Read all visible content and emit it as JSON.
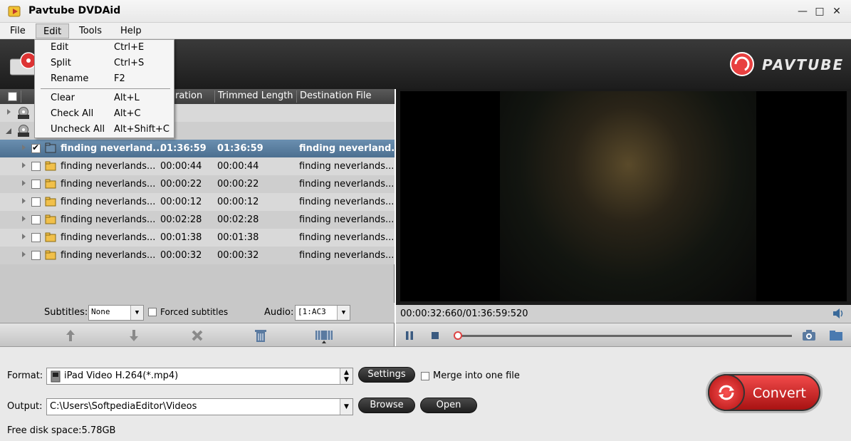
{
  "window": {
    "title": "Pavtube DVDAid",
    "controls": {
      "minimize": "—",
      "maximize": "□",
      "close": "✕"
    }
  },
  "menubar": [
    "File",
    "Edit",
    "Tools",
    "Help"
  ],
  "edit_menu": [
    {
      "label": "Edit",
      "shortcut": "Ctrl+E"
    },
    {
      "label": "Split",
      "shortcut": "Ctrl+S"
    },
    {
      "label": "Rename",
      "shortcut": "F2"
    },
    {
      "label": "Clear",
      "shortcut": "Alt+L"
    },
    {
      "label": "Check All",
      "shortcut": "Alt+C"
    },
    {
      "label": "Uncheck All",
      "shortcut": "Alt+Shift+C"
    }
  ],
  "brand": {
    "name": "PAVTUBE",
    "color": "#e84040"
  },
  "list": {
    "columns": [
      "ration",
      "Trimmed Length",
      "Destination File"
    ],
    "rows": [
      {
        "name": "finding neverland...",
        "duration": "01:36:59",
        "trimmed": "01:36:59",
        "dest": "finding neverland...",
        "checked": true,
        "selected": true
      },
      {
        "name": "finding neverlands...",
        "duration": "00:00:44",
        "trimmed": "00:00:44",
        "dest": "finding neverlands...",
        "checked": false,
        "selected": false
      },
      {
        "name": "finding neverlands...",
        "duration": "00:00:22",
        "trimmed": "00:00:22",
        "dest": "finding neverlands...",
        "checked": false,
        "selected": false
      },
      {
        "name": "finding neverlands...",
        "duration": "00:00:12",
        "trimmed": "00:00:12",
        "dest": "finding neverlands...",
        "checked": false,
        "selected": false
      },
      {
        "name": "finding neverlands...",
        "duration": "00:02:28",
        "trimmed": "00:02:28",
        "dest": "finding neverlands...",
        "checked": false,
        "selected": false
      },
      {
        "name": "finding neverlands...",
        "duration": "00:01:38",
        "trimmed": "00:01:38",
        "dest": "finding neverlands...",
        "checked": false,
        "selected": false
      },
      {
        "name": "finding neverlands...",
        "duration": "00:00:32",
        "trimmed": "00:00:32",
        "dest": "finding neverlands...",
        "checked": false,
        "selected": false
      }
    ]
  },
  "subtitles": {
    "label": "Subtitles:",
    "value": "None",
    "forced_label": "Forced subtitles",
    "audio_label": "Audio:",
    "audio_value": "[1:AC3"
  },
  "preview": {
    "time": "00:00:32:660/01:36:59:520",
    "progress": 0.0056
  },
  "format": {
    "label": "Format:",
    "value": "iPad Video H.264(*.mp4)",
    "settings": "Settings",
    "merge": "Merge into one file"
  },
  "output": {
    "label": "Output:",
    "value": "C:\\Users\\SoftpediaEditor\\Videos",
    "browse": "Browse",
    "open": "Open"
  },
  "disk": "Free disk space:5.78GB",
  "convert": "Convert"
}
